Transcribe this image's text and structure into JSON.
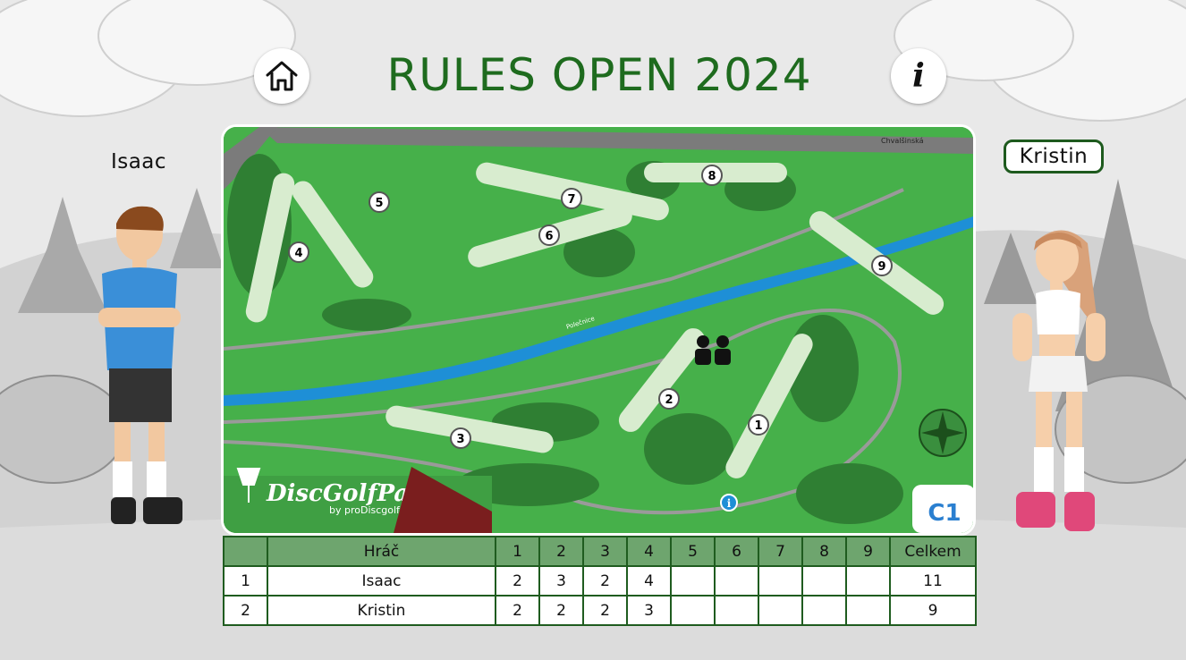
{
  "title": "RULES OPEN 2024",
  "players": {
    "left": "Isaac",
    "right": "Kristin"
  },
  "map": {
    "brand": "DiscGolfPark",
    "brand_sub": "by proDiscgolf.cz",
    "course_code": "C1",
    "street_label": "Chvalšinská",
    "river_label": "Polečnice",
    "holes": [
      "1",
      "2",
      "3",
      "4",
      "5",
      "6",
      "7",
      "8",
      "9"
    ]
  },
  "scorecard": {
    "headers": [
      "",
      "Hráč",
      "1",
      "2",
      "3",
      "4",
      "5",
      "6",
      "7",
      "8",
      "9",
      "Celkem"
    ],
    "rows": [
      {
        "no": "1",
        "player": "Isaac",
        "scores": [
          "2",
          "3",
          "2",
          "4",
          "",
          "",
          "",
          "",
          ""
        ],
        "total": "11"
      },
      {
        "no": "2",
        "player": "Kristin",
        "scores": [
          "2",
          "2",
          "2",
          "3",
          "",
          "",
          "",
          "",
          ""
        ],
        "total": "9"
      }
    ]
  },
  "colors": {
    "title": "#1e6b1e",
    "grass": "#46b04a",
    "fairway": "#d8eccf",
    "river": "#1e8fd6",
    "table_header": "#6ea56e",
    "table_border": "#1f5c1f"
  }
}
